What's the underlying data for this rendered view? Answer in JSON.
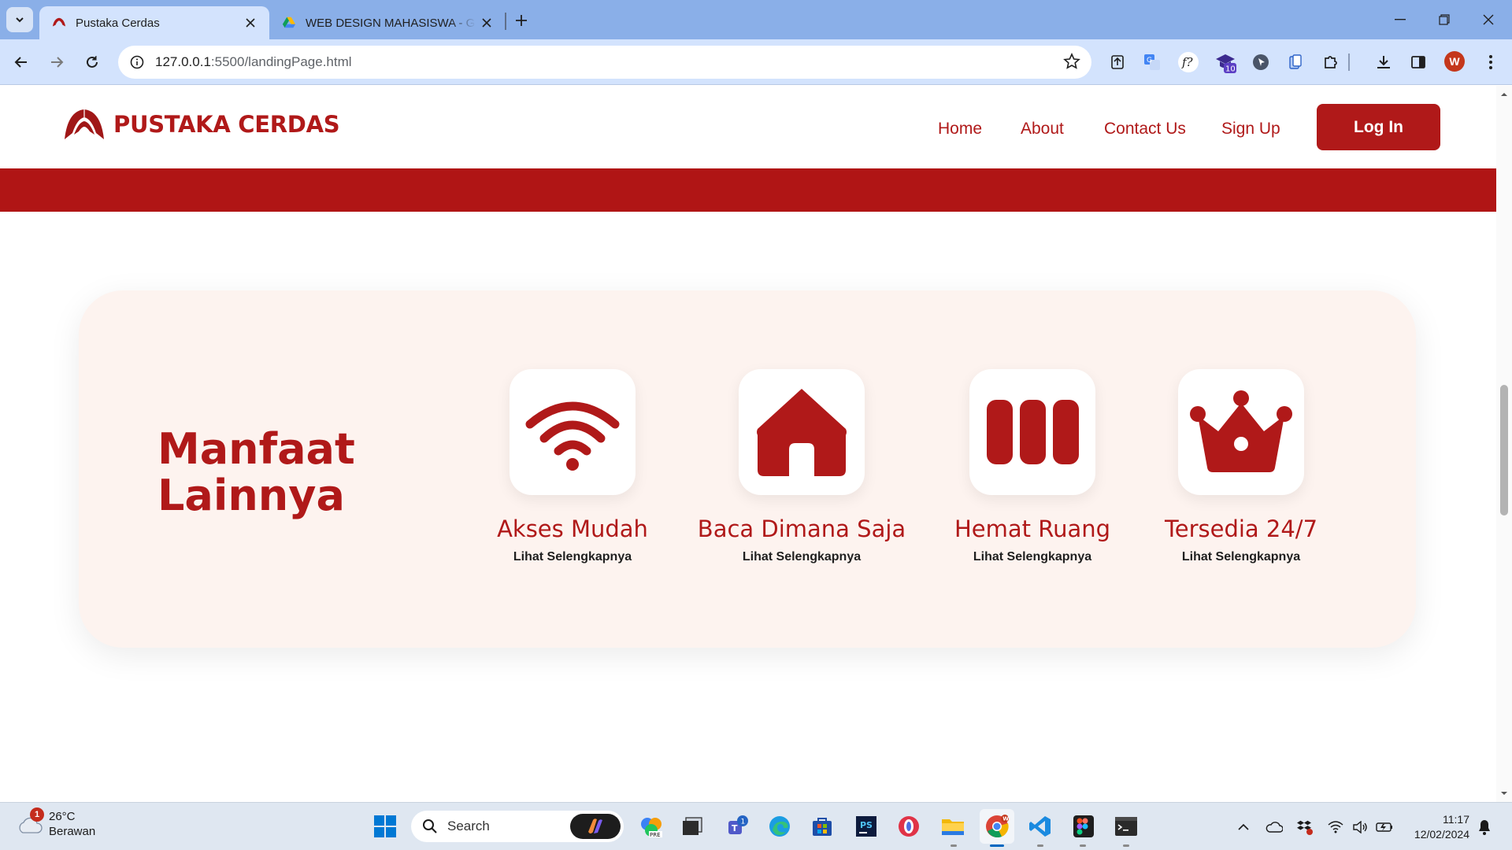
{
  "browser": {
    "tabs": [
      {
        "title": "Pustaka Cerdas",
        "active": true
      },
      {
        "title": "WEB DESIGN MAHASISWA - Goo",
        "active": false
      }
    ],
    "url_host": "127.0.0.1",
    "url_path": ":5500/landingPage.html",
    "profile_initial": "W",
    "extension_badge": "10"
  },
  "site": {
    "brand": "PUSTAKA CERDAS",
    "nav": [
      "Home",
      "About",
      "Contact Us",
      "Sign Up"
    ],
    "login_label": "Log In",
    "brand_color": "#b01919"
  },
  "benefits_section": {
    "title": "Manfaat Lainnya",
    "items": [
      {
        "icon": "wifi-icon",
        "title": "Akses Mudah",
        "link": "Lihat Selengkapnya"
      },
      {
        "icon": "home-icon",
        "title": "Baca Dimana Saja",
        "link": "Lihat Selengkapnya"
      },
      {
        "icon": "columns-icon",
        "title": "Hemat Ruang",
        "link": "Lihat Selengkapnya"
      },
      {
        "icon": "crown-icon",
        "title": "Tersedia 24/7",
        "link": "Lihat Selengkapnya"
      }
    ]
  },
  "taskbar": {
    "weather_temp": "26°C",
    "weather_desc": "Berawan",
    "weather_badge": "1",
    "search_placeholder": "Search",
    "teams_badge": "1",
    "time": "11:17",
    "date": "12/02/2024"
  }
}
